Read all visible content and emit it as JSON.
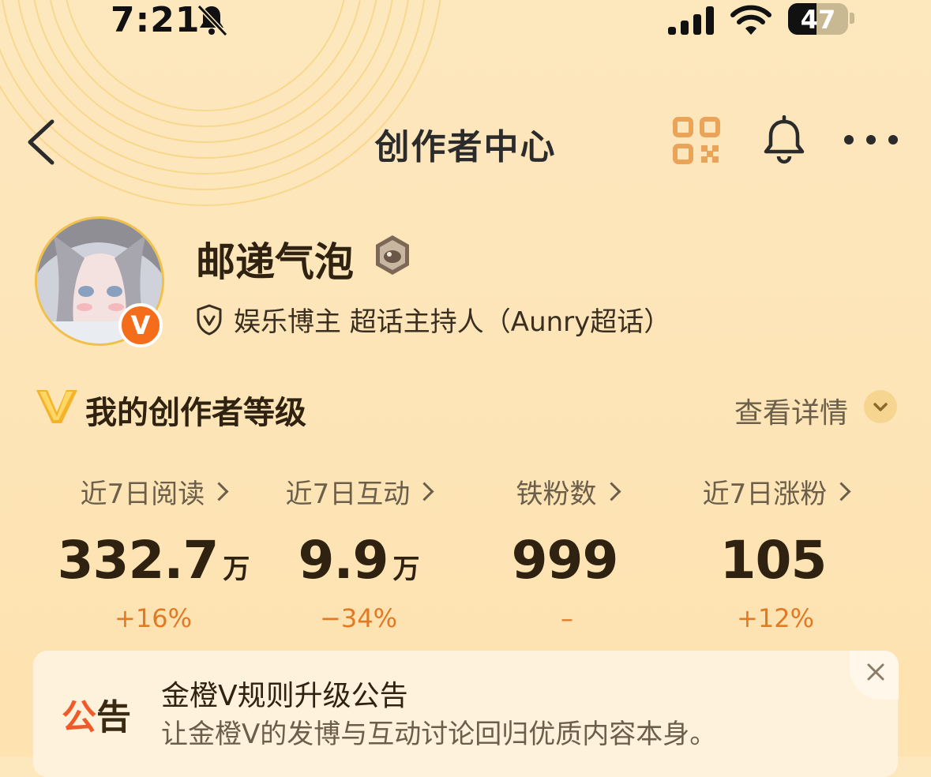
{
  "status_bar": {
    "time": "7:21",
    "battery": "47",
    "battery_level": 0.47,
    "icons": [
      "bell-slash-icon",
      "signal-icon",
      "wifi-icon",
      "battery-icon"
    ]
  },
  "header": {
    "title": "创作者中心",
    "icons": [
      "back-chevron-icon",
      "qr-code-icon",
      "bell-icon",
      "more-icon"
    ]
  },
  "profile": {
    "name": "邮递气泡",
    "verified_badge": "V",
    "tag": "娱乐博主 超话主持人（Aunry超话）"
  },
  "level": {
    "title": "我的创作者等级",
    "details_label": "查看详情"
  },
  "stats": [
    {
      "label": "近7日阅读",
      "value": "332.7",
      "unit": "万",
      "change": "+16%"
    },
    {
      "label": "近7日互动",
      "value": "9.9",
      "unit": "万",
      "change": "−34%"
    },
    {
      "label": "铁粉数",
      "value": "999",
      "unit": "",
      "change": "–"
    },
    {
      "label": "近7日涨粉",
      "value": "105",
      "unit": "",
      "change": "+12%"
    }
  ],
  "notice": {
    "tag_part1": "公",
    "tag_part2": "告",
    "title": "金橙V规则升级公告",
    "subtitle": "让金橙V的发博与互动讨论回归优质内容本身。"
  },
  "colors": {
    "background": "#fde5b8",
    "accent_orange": "#f36d1a",
    "change_text": "#e07a24",
    "qr_orange": "#e9a45a"
  }
}
